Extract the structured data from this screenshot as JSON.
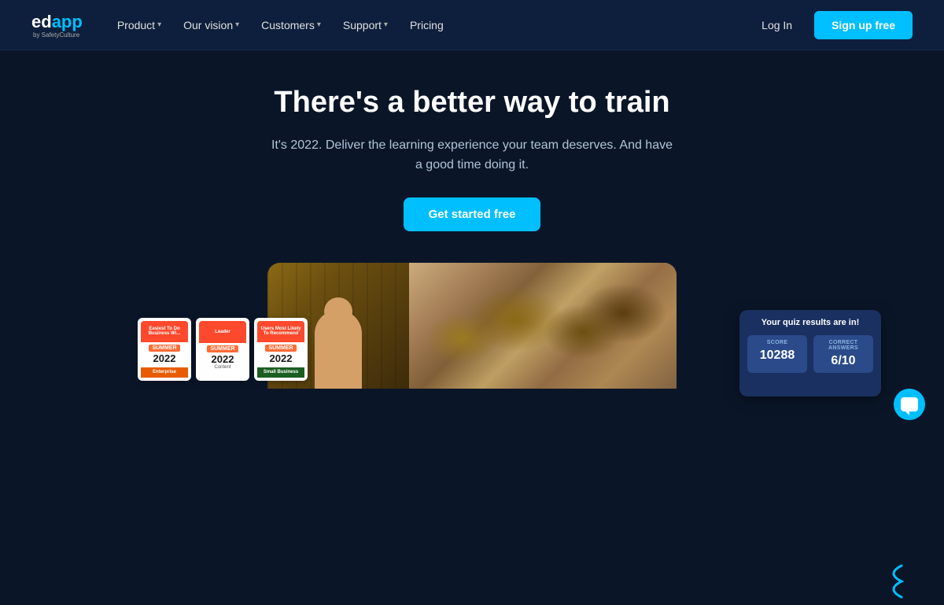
{
  "brand": {
    "name_ed": "ed",
    "name_app": "app",
    "sub": "by SafetyCulture"
  },
  "nav": {
    "items": [
      {
        "label": "Product",
        "has_dropdown": true
      },
      {
        "label": "Our vision",
        "has_dropdown": true
      },
      {
        "label": "Customers",
        "has_dropdown": true
      },
      {
        "label": "Support",
        "has_dropdown": true
      },
      {
        "label": "Pricing",
        "has_dropdown": false
      }
    ],
    "login_label": "Log In",
    "signup_label": "Sign up free"
  },
  "hero": {
    "title": "There's a better way to train",
    "subtitle": "It's 2022. Deliver the learning experience your team deserves. And have a good time doing it.",
    "cta_label": "Get started free"
  },
  "badges": [
    {
      "top_text": "Easiest To Do Business Wi...",
      "season": "SUMMER",
      "year": "2022",
      "category": "Enterprise"
    },
    {
      "leader_text": "Leader",
      "season": "SUMMER",
      "year": "2022",
      "category": "Content"
    },
    {
      "top_text": "Users Most Likely To Recommend",
      "season": "SUMMER",
      "year": "2022",
      "category": "Small Business"
    }
  ],
  "quiz_card": {
    "title": "Your quiz results are in!",
    "stats": [
      {
        "label": "SCORE",
        "value": "10288"
      },
      {
        "label": "CORRECT ANSWERS",
        "value": "6/10"
      }
    ]
  },
  "colors": {
    "bg": "#0a1628",
    "nav_bg": "#0d1f3c",
    "accent": "#00bfff",
    "cta": "#00bfff"
  }
}
